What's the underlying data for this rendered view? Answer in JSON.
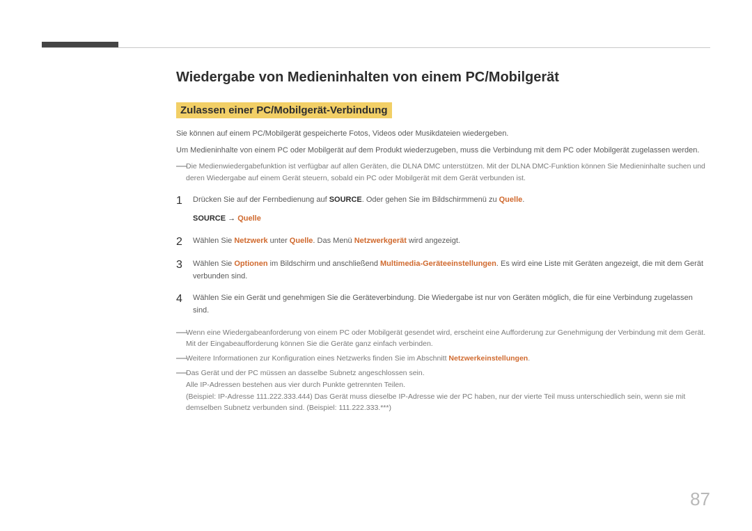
{
  "page": {
    "title": "Wiedergabe von Medieninhalten von einem PC/Mobilgerät",
    "subtitle": "Zulassen einer PC/Mobilgerät-Verbindung",
    "intro1": "Sie können auf einem PC/Mobilgerät gespeicherte Fotos, Videos oder Musikdateien wiedergeben.",
    "intro2": "Um Medieninhalte von einem PC oder Mobilgerät auf dem Produkt wiederzugeben, muss die Verbindung mit dem PC oder Mobilgerät zugelassen werden.",
    "topnote": "Die Medienwiedergabefunktion ist verfügbar auf allen Geräten, die DLNA DMC unterstützen. Mit der DLNA DMC-Funktion können Sie Medieninhalte suchen und deren Wiedergabe auf einem Gerät steuern, sobald ein PC oder Mobilgerät mit dem Gerät verbunden ist.",
    "steps": [
      {
        "num": "1",
        "text_pre": "Drücken Sie auf der Fernbedienung auf ",
        "k1": "SOURCE",
        "text_mid": ". Oder gehen Sie im Bildschirmmenü zu ",
        "a1": "Quelle",
        "text_post": ".",
        "sub_k": "SOURCE",
        "sub_arrow": " → ",
        "sub_a": "Quelle"
      },
      {
        "num": "2",
        "text_pre": "Wählen Sie ",
        "a1": "Netzwerk",
        "text_mid": " unter ",
        "a2": "Quelle",
        "text_mid2": ". Das Menü ",
        "a3": "Netzwerkgerät",
        "text_post": " wird angezeigt."
      },
      {
        "num": "3",
        "text_pre": "Wählen Sie ",
        "a1": "Optionen",
        "text_mid": " im Bildschirm und anschließend ",
        "a2": "Multimedia-Geräteeinstellungen",
        "text_post": ". Es wird eine Liste mit Geräten angezeigt, die mit dem Gerät verbunden sind."
      },
      {
        "num": "4",
        "text": "Wählen Sie ein Gerät und genehmigen Sie die Geräteverbindung. Die Wiedergabe ist nur von Geräten möglich, die für eine Verbindung zugelassen sind."
      }
    ],
    "notes": [
      {
        "t": "Wenn eine Wiedergabeanforderung von einem PC oder Mobilgerät gesendet wird, erscheint eine Aufforderung zur Genehmigung der Verbindung mit dem Gerät. Mit der Eingabeaufforderung können Sie die Geräte ganz einfach verbinden."
      },
      {
        "pre": "Weitere Informationen zur Konfiguration eines Netzwerks finden Sie im Abschnitt ",
        "a": "Netzwerkeinstellungen",
        "post": "."
      },
      {
        "t": "Das Gerät und der PC müssen an dasselbe Subnetz angeschlossen sein.",
        "sub1": "Alle IP-Adressen bestehen aus vier durch Punkte getrennten Teilen.",
        "sub2": "(Beispiel: IP-Adresse 111.222.333.444) Das Gerät muss dieselbe IP-Adresse wie der PC haben, nur der vierte Teil muss unterschiedlich sein, wenn sie mit demselben Subnetz verbunden sind. (Beispiel: 111.222.333.***)"
      }
    ],
    "pagenum": "87"
  }
}
